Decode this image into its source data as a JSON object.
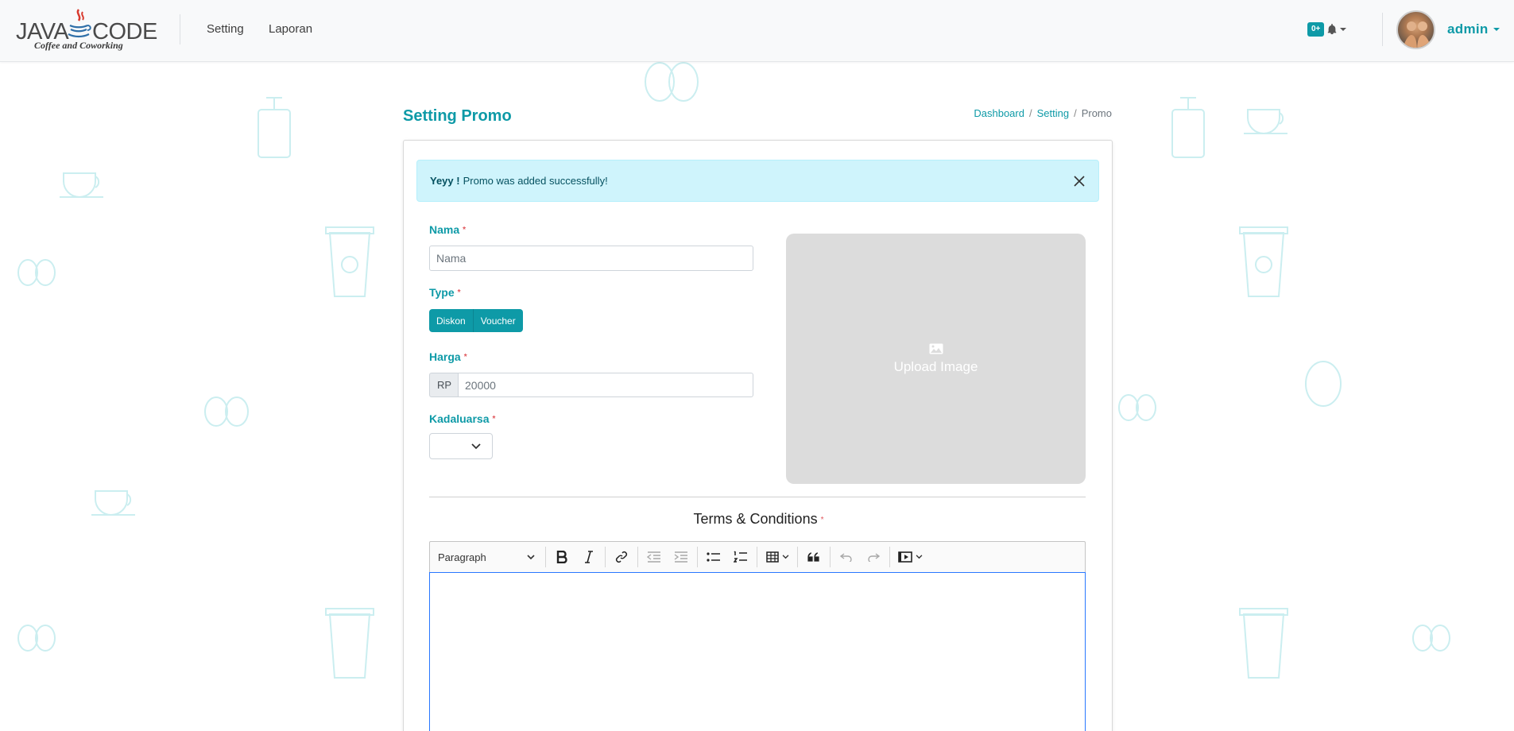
{
  "brand": {
    "name_left": "JAVA",
    "name_right": "CODE",
    "tagline": "Coffee and Coworking"
  },
  "navbar": {
    "links": [
      "Setting",
      "Laporan"
    ],
    "notification_badge": "0+",
    "user_name": "admin"
  },
  "page": {
    "title": "Setting Promo",
    "breadcrumb": [
      "Dashboard",
      "Setting",
      "Promo"
    ]
  },
  "alert": {
    "strong": "Yeyy !",
    "message": "Promo was added successfully!"
  },
  "form": {
    "nama_label": "Nama",
    "nama_placeholder": "Nama",
    "type_label": "Type",
    "type_options": [
      "Diskon",
      "Voucher"
    ],
    "harga_label": "Harga",
    "currency_prefix": "RP",
    "harga_placeholder": "20000",
    "kadaluarsa_label": "Kadaluarsa",
    "required_marker": "*",
    "upload_label": "Upload Image"
  },
  "terms": {
    "title": "Terms & Conditions",
    "paragraph_select": "Paragraph"
  },
  "icons": [
    "bell-icon",
    "close-icon",
    "image-icon",
    "bold-icon",
    "italic-icon",
    "link-icon",
    "outdent-icon",
    "indent-icon",
    "bulleted-list-icon",
    "numbered-list-icon",
    "table-icon",
    "blockquote-icon",
    "undo-icon",
    "redo-icon",
    "media-embed-icon",
    "chevron-down-icon"
  ],
  "colors": {
    "accent": "#0e9aa7",
    "alert_bg": "#cff4fc",
    "required": "#e0565b",
    "editor_focus": "#2977ff"
  }
}
